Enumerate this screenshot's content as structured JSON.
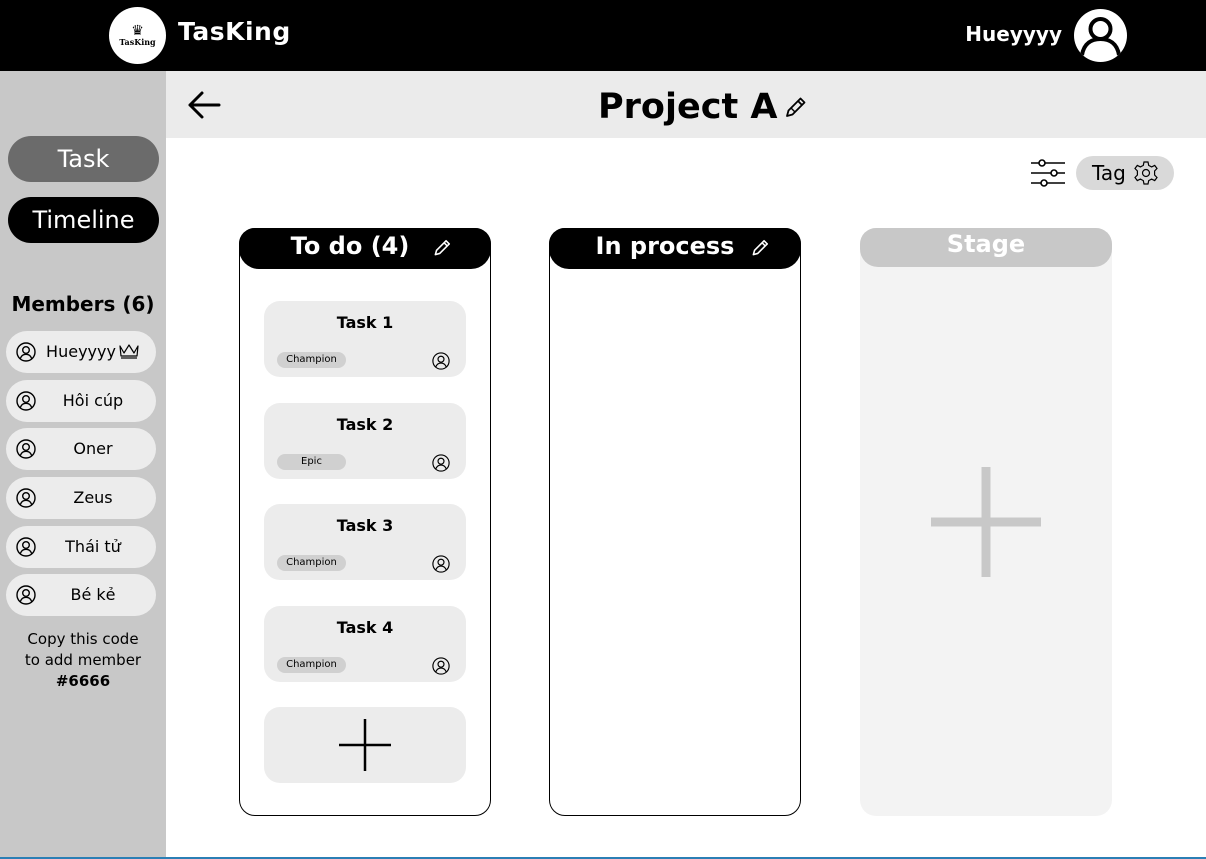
{
  "app": {
    "logo_text": "TasKing",
    "name": "TasKing"
  },
  "user": {
    "name": "Hueyyyy"
  },
  "sidebar": {
    "nav": {
      "task_label": "Task",
      "timeline_label": "Timeline"
    },
    "members_title": "Members (6)",
    "members": [
      {
        "name": "Hueyyyy",
        "is_owner": true
      },
      {
        "name": "Hôi cúp"
      },
      {
        "name": "Oner"
      },
      {
        "name": "Zeus"
      },
      {
        "name": "Thái tử"
      },
      {
        "name": "Bé kẻ"
      }
    ],
    "copy_note_line1": "Copy this code",
    "copy_note_line2": "to add member",
    "invite_code": "#6666"
  },
  "header": {
    "title": "Project A"
  },
  "toolbar": {
    "tag_label": "Tag"
  },
  "board": {
    "columns": [
      {
        "title": "To do (4)",
        "cards": [
          {
            "title": "Task 1",
            "tag": "Champion"
          },
          {
            "title": "Task 2",
            "tag": "Epic"
          },
          {
            "title": "Task 3",
            "tag": "Champion"
          },
          {
            "title": "Task 4",
            "tag": "Champion"
          }
        ]
      },
      {
        "title": "In process",
        "cards": []
      },
      {
        "title": "Stage",
        "cards": []
      }
    ]
  },
  "icons": {
    "logo": "crown-emblem-icon",
    "avatar": "user-circle-icon",
    "back": "arrow-left-icon",
    "edit": "pencil-icon",
    "filter": "sliders-icon",
    "tag_settings": "gear-icon",
    "owner": "crown-icon",
    "add": "plus-icon"
  },
  "colors": {
    "topbar": "#000000",
    "sidebar": "#c8c8c8",
    "header": "#ebebeb",
    "card": "#ececec",
    "tag": "#d0d0d0",
    "active_nav": "#6b6b6b",
    "stage_column": "#f3f3f3",
    "stage_header": "#c8c8c8"
  }
}
